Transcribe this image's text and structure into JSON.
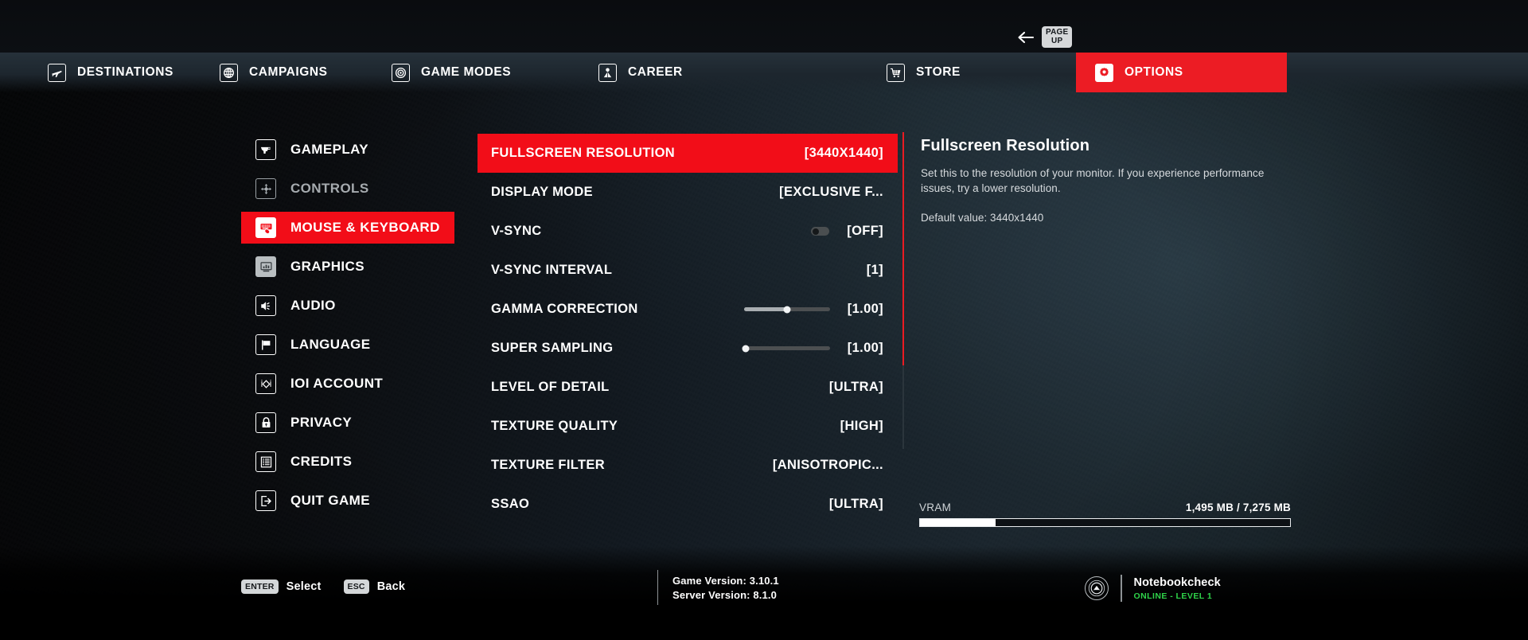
{
  "topbar": {
    "back_icon": "arrow-left-icon",
    "pageup_key_line1": "PAGE",
    "pageup_key_line2": "UP"
  },
  "nav": {
    "active_color": "#ec1c24",
    "items": [
      {
        "label": "DESTINATIONS",
        "icon": "airplane-icon",
        "active": false
      },
      {
        "label": "CAMPAIGNS",
        "icon": "globe-icon",
        "active": false
      },
      {
        "label": "GAME MODES",
        "icon": "target-icon",
        "active": false
      },
      {
        "label": "CAREER",
        "icon": "person-icon",
        "active": false
      },
      {
        "label": "STORE",
        "icon": "shopping-cart-icon",
        "active": false
      },
      {
        "label": "OPTIONS",
        "icon": "gear-icon",
        "active": true
      }
    ]
  },
  "sidebar": {
    "active_color": "#f20d18",
    "items": [
      {
        "label": "GAMEPLAY",
        "icon": "pistol-icon",
        "state": "normal"
      },
      {
        "label": "CONTROLS",
        "icon": "dpad-arrows-icon",
        "state": "dim"
      },
      {
        "label": "MOUSE & KEYBOARD",
        "icon": "keyboard-mouse-icon",
        "state": "active"
      },
      {
        "label": "GRAPHICS",
        "icon": "monitor-chart-icon",
        "state": "grey"
      },
      {
        "label": "AUDIO",
        "icon": "speaker-icon",
        "state": "normal"
      },
      {
        "label": "LANGUAGE",
        "icon": "flag-icon",
        "state": "normal"
      },
      {
        "label": "IOI ACCOUNT",
        "icon": "ioi-diamond-icon",
        "state": "normal"
      },
      {
        "label": "PRIVACY",
        "icon": "lock-icon",
        "state": "normal"
      },
      {
        "label": "CREDITS",
        "icon": "list-document-icon",
        "state": "normal"
      },
      {
        "label": "QUIT GAME",
        "icon": "exit-arrow-icon",
        "state": "normal"
      }
    ]
  },
  "settings": {
    "rows": [
      {
        "name": "FULLSCREEN RESOLUTION",
        "value": "[3440X1440]",
        "selected": true,
        "control": "none"
      },
      {
        "name": "DISPLAY MODE",
        "value": "[EXCLUSIVE F...",
        "selected": false,
        "control": "none"
      },
      {
        "name": "V-SYNC",
        "value": "[OFF]",
        "selected": false,
        "control": "toggle",
        "toggle_on": false
      },
      {
        "name": "V-SYNC INTERVAL",
        "value": "[1]",
        "selected": false,
        "control": "none"
      },
      {
        "name": "GAMMA CORRECTION",
        "value": "[1.00]",
        "selected": false,
        "control": "slider",
        "slider_percent": 50
      },
      {
        "name": "SUPER SAMPLING",
        "value": "[1.00]",
        "selected": false,
        "control": "slider",
        "slider_percent": 2
      },
      {
        "name": "LEVEL OF DETAIL",
        "value": "[ULTRA]",
        "selected": false,
        "control": "none"
      },
      {
        "name": "TEXTURE QUALITY",
        "value": "[HIGH]",
        "selected": false,
        "control": "none"
      },
      {
        "name": "TEXTURE FILTER",
        "value": "[ANISOTROPIC...",
        "selected": false,
        "control": "none"
      },
      {
        "name": "SSAO",
        "value": "[ULTRA]",
        "selected": false,
        "control": "none"
      }
    ]
  },
  "description": {
    "title": "Fullscreen Resolution",
    "body": "Set this to the resolution of your monitor. If you experience performance issues, try a lower resolution.",
    "default_value": "Default value: 3440x1440"
  },
  "vram": {
    "label": "VRAM",
    "value": "1,495 MB / 7,275 MB",
    "used_mb": 1495,
    "total_mb": 7275,
    "percent": 20.5
  },
  "footer": {
    "hints": [
      {
        "key": "ENTER",
        "action": "Select"
      },
      {
        "key": "ESC",
        "action": "Back"
      }
    ],
    "game_version": "Game Version: 3.10.1",
    "server_version": "Server Version: 8.1.0",
    "profile": {
      "avatar_icon": "notebookcheck-logo-icon",
      "name": "Notebookcheck",
      "status": "ONLINE - LEVEL 1",
      "status_color": "#2fd34a"
    }
  }
}
